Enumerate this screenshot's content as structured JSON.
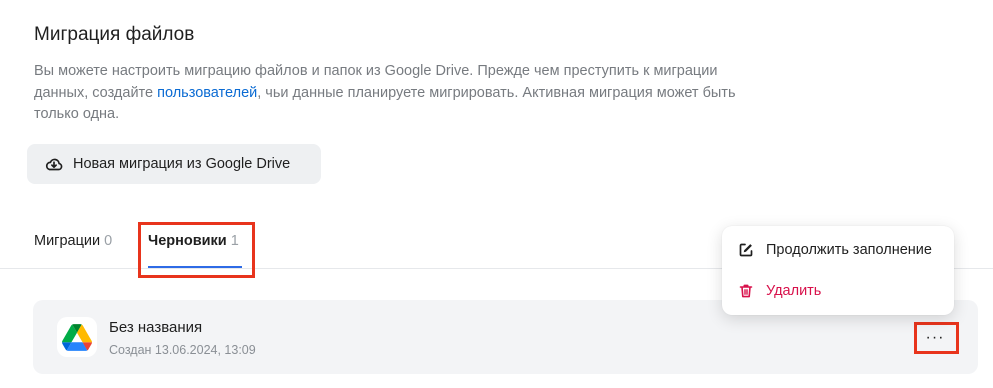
{
  "page": {
    "title": "Миграция файлов",
    "description_part1": "Вы можете настроить миграцию файлов и папок из Google Drive. Прежде чем преступить к миграции данных, создайте ",
    "description_link": "пользователей",
    "description_part2": ", чьи данные планируете мигрировать. Активная миграция может быть только одна."
  },
  "actions": {
    "new_migration_label": "Новая миграция из Google Drive",
    "new_migration_icon": "cloud-download-icon"
  },
  "tabs": [
    {
      "label": "Миграции",
      "count": "0",
      "active": false
    },
    {
      "label": "Черновики",
      "count": "1",
      "active": true
    }
  ],
  "draft": {
    "title": "Без названия",
    "created": "Создан 13.06.2024, 13:09",
    "icon": "google-drive-icon",
    "more_label": "···"
  },
  "menu": {
    "items": [
      {
        "label": "Продолжить заполнение",
        "icon": "edit-icon"
      },
      {
        "label": "Удалить",
        "icon": "trash-icon"
      }
    ]
  },
  "colors": {
    "accent": "#2e6be6",
    "link": "#0b6bd3",
    "danger": "#d8114b",
    "highlight": "#e8341c"
  }
}
